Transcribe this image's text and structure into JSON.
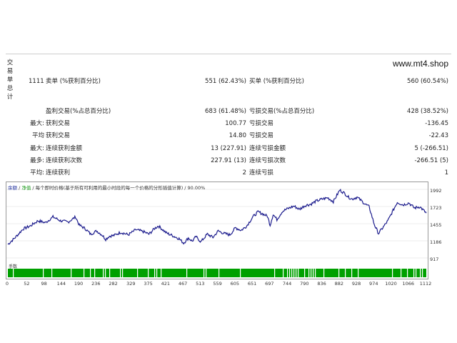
{
  "side_title": [
    "交",
    "易",
    "单",
    "总",
    "计"
  ],
  "site": "www.mt4.shop",
  "rows": [
    {
      "l1": "1111",
      "l2": "卖单 (%获利百分比)",
      "v1": "551 (62.43%)",
      "l3": "买单 (%获利百分比)",
      "v2": "560 (60.54%)"
    },
    {
      "l1": "",
      "l2": "盈利交易(%占总百分比)",
      "v1": "683 (61.48%)",
      "l3": "亏损交易(%占总百分比)",
      "v2": "428 (38.52%)"
    },
    {
      "l1": "最大:",
      "l2": "获利交易",
      "v1": "100.77",
      "l3": "亏损交易",
      "v2": "-136.45"
    },
    {
      "l1": "平均",
      "l2": "获利交易",
      "v1": "14.80",
      "l3": "亏损交易",
      "v2": "-22.43"
    },
    {
      "l1": "最大:",
      "l2": "连续获利金额",
      "v1": "13 (227.91)",
      "l3": "连续亏损金额",
      "v2": "5 (-266.51)"
    },
    {
      "l1": "最多:",
      "l2": "连续获利次数",
      "v1": "227.91 (13)",
      "l3": "连续亏损次数",
      "v2": "-266.51 (5)"
    },
    {
      "l1": "平均:",
      "l2": "连续获利",
      "v1": "2",
      "l3": "连续亏损",
      "v2": "1"
    }
  ],
  "chart_legend": {
    "balance": "余额",
    "equity": "净值",
    "desc": "每个即时价格(基于所有可利用的最小时段的每一个价格的分形插值计算) / 90.00%"
  },
  "volume_label": "手数",
  "colors": {
    "balance_line": "#1a1a8c",
    "volume_bars": "#00a000"
  },
  "chart_data": {
    "type": "line",
    "yticks": [
      1992,
      1723,
      1455,
      1186,
      917
    ],
    "ylim": [
      917,
      1992
    ],
    "xticks": [
      "0",
      "52",
      "98",
      "144",
      "190",
      "236",
      "282",
      "329",
      "375",
      "421",
      "467",
      "513",
      "559",
      "605",
      "651",
      "697",
      "744",
      "790",
      "836",
      "882",
      "928",
      "974",
      "1020",
      "1066",
      "1112"
    ],
    "xlim": [
      0,
      1112
    ],
    "series": [
      {
        "x": [
          0,
          20,
          40,
          60,
          80,
          100,
          120,
          140,
          160,
          180,
          190,
          205,
          220,
          236,
          250,
          260,
          270,
          282,
          300,
          320,
          340,
          360,
          375,
          390,
          400,
          421,
          440,
          455,
          467,
          480,
          490,
          500,
          513,
          530,
          545,
          559,
          575,
          590,
          605,
          620,
          635,
          651,
          665,
          680,
          690,
          697,
          705,
          715,
          730,
          744,
          760,
          775,
          790,
          805,
          820,
          836,
          850,
          865,
          882,
          895,
          905,
          915,
          928,
          940,
          950,
          960,
          966,
          974,
          985,
          995,
          1000,
          1010,
          1020,
          1035,
          1050,
          1066,
          1080,
          1095,
          1112
        ],
        "values": [
          1130,
          1240,
          1370,
          1420,
          1500,
          1470,
          1560,
          1500,
          1480,
          1560,
          1430,
          1380,
          1290,
          1340,
          1280,
          1210,
          1260,
          1270,
          1320,
          1280,
          1360,
          1330,
          1290,
          1380,
          1420,
          1310,
          1260,
          1220,
          1150,
          1230,
          1180,
          1250,
          1170,
          1290,
          1240,
          1340,
          1300,
          1280,
          1390,
          1350,
          1420,
          1560,
          1640,
          1600,
          1570,
          1430,
          1600,
          1520,
          1650,
          1690,
          1730,
          1680,
          1740,
          1760,
          1810,
          1840,
          1860,
          1800,
          1980,
          1930,
          1870,
          1840,
          1870,
          1810,
          1760,
          1720,
          1600,
          1440,
          1300,
          1380,
          1420,
          1500,
          1620,
          1790,
          1750,
          1780,
          1700,
          1720,
          1620
        ]
      }
    ],
    "volume": [
      1
    ]
  }
}
